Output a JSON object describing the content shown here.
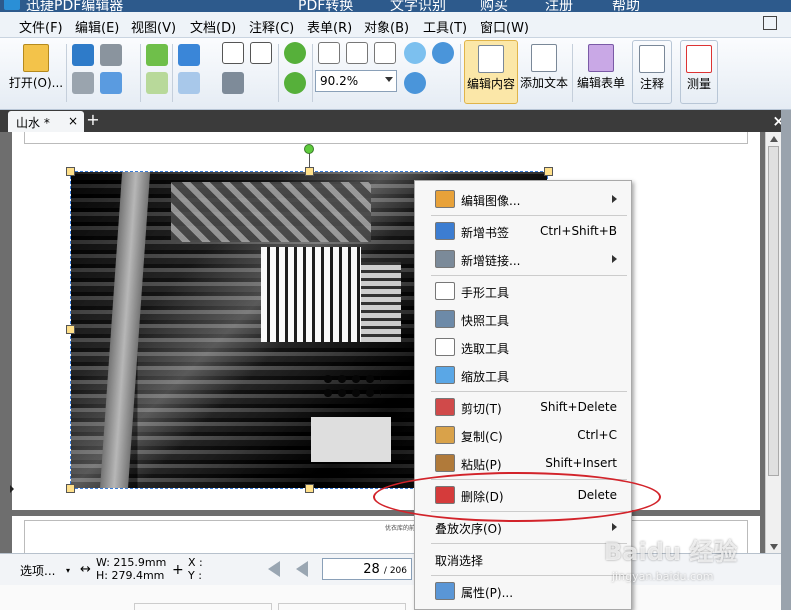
{
  "app": {
    "title": "迅捷PDF编辑器",
    "title_tools": [
      "PDF转换",
      "文字识别",
      "购买",
      "注册",
      "帮助"
    ]
  },
  "menu": [
    "文件(F)",
    "编辑(E)",
    "视图(V)",
    "文档(D)",
    "注释(C)",
    "表单(R)",
    "对象(B)",
    "工具(T)",
    "窗口(W)"
  ],
  "toolbar": {
    "open_label": "打开(O)...",
    "zoom_value": "90.2%",
    "edit_content_label": "编辑内容",
    "add_text_label": "添加文本",
    "edit_form_label": "编辑表单",
    "annotate_label": "注释",
    "measure_label": "测量"
  },
  "tab": {
    "label": "山水 *",
    "close": "×",
    "add": "+"
  },
  "doc": {
    "close": "×",
    "page2_caption": "优衣库的前身\"小郡"
  },
  "status": {
    "select_label": "选项...",
    "width": "W: 215.9mm",
    "height": "H: 279.4mm",
    "x_label": "X :",
    "y_label": "Y :",
    "page_current": "28",
    "page_total": "/ 206"
  },
  "context_menu": [
    {
      "label": "编辑图像...",
      "shortcut": "",
      "submenu": true,
      "icon": "edit-image-icon"
    },
    {
      "sep": true
    },
    {
      "label": "新增书签",
      "shortcut": "Ctrl+Shift+B",
      "submenu": false,
      "icon": "bookmark-icon"
    },
    {
      "label": "新增链接...",
      "shortcut": "",
      "submenu": true,
      "icon": "link-icon"
    },
    {
      "sep": true
    },
    {
      "label": "手形工具",
      "shortcut": "",
      "submenu": false,
      "icon": "hand-icon"
    },
    {
      "label": "快照工具",
      "shortcut": "",
      "submenu": false,
      "icon": "camera-icon"
    },
    {
      "label": "选取工具",
      "shortcut": "",
      "submenu": false,
      "icon": "select-icon"
    },
    {
      "label": "缩放工具",
      "shortcut": "",
      "submenu": false,
      "icon": "zoom-icon"
    },
    {
      "sep": true
    },
    {
      "label": "剪切(T)",
      "shortcut": "Shift+Delete",
      "submenu": false,
      "icon": "scissors-icon"
    },
    {
      "label": "复制(C)",
      "shortcut": "Ctrl+C",
      "submenu": false,
      "icon": "copy-icon"
    },
    {
      "label": "粘贴(P)",
      "shortcut": "Shift+Insert",
      "submenu": false,
      "icon": "paste-icon"
    },
    {
      "sep": true
    },
    {
      "label": "删除(D)",
      "shortcut": "Delete",
      "submenu": false,
      "icon": "delete-icon"
    },
    {
      "sep": true
    },
    {
      "label": "叠放次序(O)",
      "shortcut": "",
      "submenu": true,
      "icon": ""
    },
    {
      "sep": true
    },
    {
      "label": "取消选择",
      "shortcut": "",
      "submenu": false,
      "icon": ""
    },
    {
      "sep": true
    },
    {
      "label": "属性(P)...",
      "shortcut": "",
      "submenu": false,
      "icon": "properties-icon"
    }
  ],
  "watermark": {
    "main": "Baidu 经验",
    "sub": "jingyan.baidu.com"
  },
  "colors": {
    "accent": "#3a7bd5",
    "highlight_oval": "#d2232a",
    "tabbar": "#3b3b3b"
  }
}
